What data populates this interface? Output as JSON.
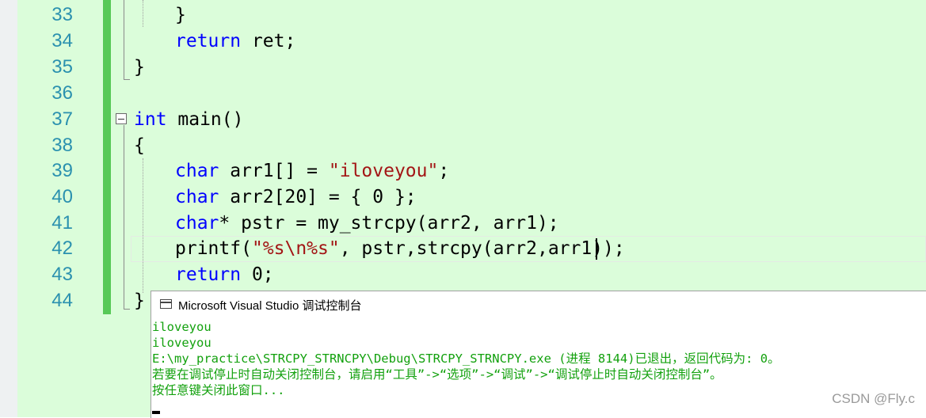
{
  "editor": {
    "lines": [
      {
        "num": "33",
        "code": [
          {
            "t": "}",
            "c": "plain"
          }
        ]
      },
      {
        "num": "34",
        "code": [
          {
            "t": "return",
            "c": "kw"
          },
          {
            "t": " ret;",
            "c": "plain"
          }
        ]
      },
      {
        "num": "35",
        "code": [
          {
            "t": "}",
            "c": "plain"
          }
        ]
      },
      {
        "num": "36",
        "code": []
      },
      {
        "num": "37",
        "code": [
          {
            "t": "int",
            "c": "kw"
          },
          {
            "t": " main()",
            "c": "plain"
          }
        ]
      },
      {
        "num": "38",
        "code": [
          {
            "t": "{",
            "c": "plain"
          }
        ]
      },
      {
        "num": "39",
        "code": [
          {
            "t": "char",
            "c": "kw"
          },
          {
            "t": " arr1[] = ",
            "c": "plain"
          },
          {
            "t": "\"iloveyou\"",
            "c": "str"
          },
          {
            "t": ";",
            "c": "plain"
          }
        ]
      },
      {
        "num": "40",
        "code": [
          {
            "t": "char",
            "c": "kw"
          },
          {
            "t": " arr2[20] = { 0 };",
            "c": "plain"
          }
        ]
      },
      {
        "num": "41",
        "code": [
          {
            "t": "char",
            "c": "kw"
          },
          {
            "t": "* pstr = my_strcpy(arr2, arr1);",
            "c": "plain"
          }
        ]
      },
      {
        "num": "42",
        "code": [
          {
            "t": "printf(",
            "c": "plain"
          },
          {
            "t": "\"%s\\n%s\"",
            "c": "str"
          },
          {
            "t": ", pstr,strcpy(arr2,arr1));",
            "c": "plain"
          }
        ]
      },
      {
        "num": "43",
        "code": [
          {
            "t": "return",
            "c": "kw"
          },
          {
            "t": " 0;",
            "c": "plain"
          }
        ]
      },
      {
        "num": "44",
        "code": [
          {
            "t": "}",
            "c": "plain"
          }
        ]
      }
    ]
  },
  "console": {
    "title": "Microsoft Visual Studio 调试控制台",
    "lines": [
      "iloveyou",
      "iloveyou",
      "E:\\my_practice\\STRCPY_STRNCPY\\Debug\\STRCPY_STRNCPY.exe (进程 8144)已退出，返回代码为: 0。",
      "若要在调试停止时自动关闭控制台，请启用“工具”->“选项”->“调试”->“调试停止时自动关闭控制台”。",
      "按任意键关闭此窗口..."
    ]
  },
  "watermark": "CSDN @Fly.c",
  "colors": {
    "editor_bg": "#dbfdda",
    "line_number": "#2b91af",
    "keyword": "#0000ff",
    "string": "#a31515",
    "change_bar": "#57c957",
    "console_text": "#13a10e"
  }
}
